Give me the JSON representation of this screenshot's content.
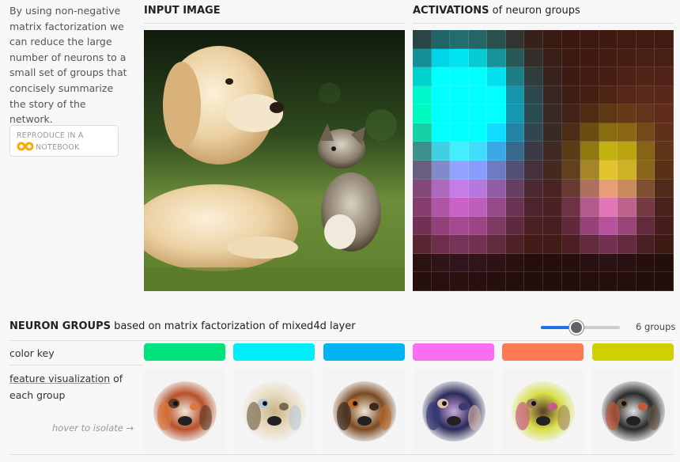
{
  "intro": {
    "text": "By using non-negative matrix factorization we can reduce the large number of neurons to a small set of groups that concisely summarize the story of the network."
  },
  "reproduce_button": {
    "line1": "REPRODUCE IN A",
    "line2": "NOTEBOOK",
    "logo": "CO"
  },
  "input_section": {
    "title": "INPUT IMAGE"
  },
  "activations_section": {
    "title_bold": "ACTIVATIONS",
    "title_rest": " of neuron groups"
  },
  "groups_section": {
    "title_bold": "NEURON GROUPS",
    "title_rest": " based on matrix factorization of mixed4d layer",
    "slider_value": 6,
    "slider_min": 1,
    "slider_max": 12,
    "count_label": "6 groups"
  },
  "rows": {
    "color_key_label": "color key",
    "fv_label_link": "feature visualization",
    "fv_label_rest": " of each group",
    "hover_hint": "hover to isolate →"
  },
  "groups": [
    {
      "color": "#00e37c",
      "icon": "puppy-beagle-visualization"
    },
    {
      "color": "#00eef8",
      "icon": "puppy-retriever-visualization"
    },
    {
      "color": "#00b4f3",
      "icon": "dog-face-visualization"
    },
    {
      "color": "#fb6ef2",
      "icon": "dog-body-visualization"
    },
    {
      "color": "#ff7a52",
      "icon": "dog-snout-visualization"
    },
    {
      "color": "#d0cf00",
      "icon": "wolf-face-visualization"
    }
  ]
}
